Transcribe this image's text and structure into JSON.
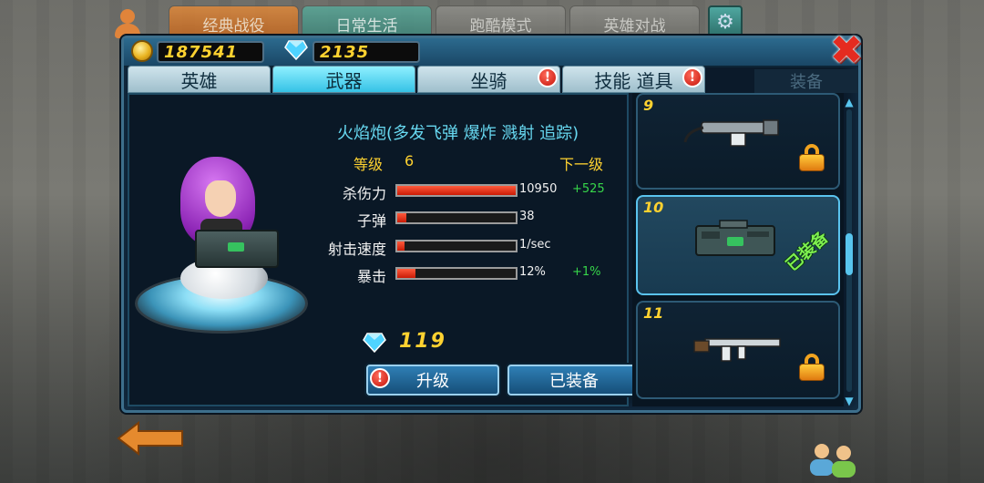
{
  "top_tabs": [
    "经典战役",
    "日常生活",
    "跑酷模式",
    "英雄对战"
  ],
  "currency": {
    "gold": "187541",
    "diamonds": "2135"
  },
  "sub_tabs": [
    {
      "label": "英雄",
      "alert": false
    },
    {
      "label": "武器",
      "alert": false
    },
    {
      "label": "坐骑",
      "alert": true
    },
    {
      "label": "技能 道具",
      "alert": true
    },
    {
      "label": "装备",
      "alert": false
    }
  ],
  "weapon": {
    "name": "火焰炮(多发飞弹 爆炸 溅射 追踪)",
    "level_label": "等级",
    "level": "6",
    "next_level_label": "下一级",
    "stats": [
      {
        "label": "杀伤力",
        "value": "10950",
        "plus": "+525",
        "fill": 1.0
      },
      {
        "label": "子弹",
        "value": "38",
        "plus": "",
        "fill": 0.08
      },
      {
        "label": "射击速度",
        "value": "1/sec",
        "plus": "",
        "fill": 0.06
      },
      {
        "label": "暴击",
        "value": "12%",
        "plus": "+1%",
        "fill": 0.15
      }
    ],
    "upgrade_cost": "119"
  },
  "buttons": {
    "upgrade": "升级",
    "equipped": "已装备"
  },
  "weapon_list": [
    {
      "number": "9",
      "locked": true,
      "equipped": false
    },
    {
      "number": "10",
      "locked": false,
      "equipped": true,
      "tag": "已装备"
    },
    {
      "number": "11",
      "locked": true,
      "equipped": false
    }
  ],
  "icons": {
    "coin": "gold-coin-icon",
    "diamond": "diamond-icon",
    "close": "close-icon",
    "settings": "gear-icon",
    "lock": "lock-icon",
    "alert": "exclamation-icon",
    "back": "back-arrow-icon",
    "friends": "friends-icon",
    "profile": "profile-icon"
  },
  "colors": {
    "gold_text": "#ffd230",
    "accent_cyan": "#35c2e6",
    "alert_red": "#c5140a",
    "bar_red": "#e0281a",
    "plus_green": "#37d64a",
    "equipped_green": "#7ef04f"
  }
}
